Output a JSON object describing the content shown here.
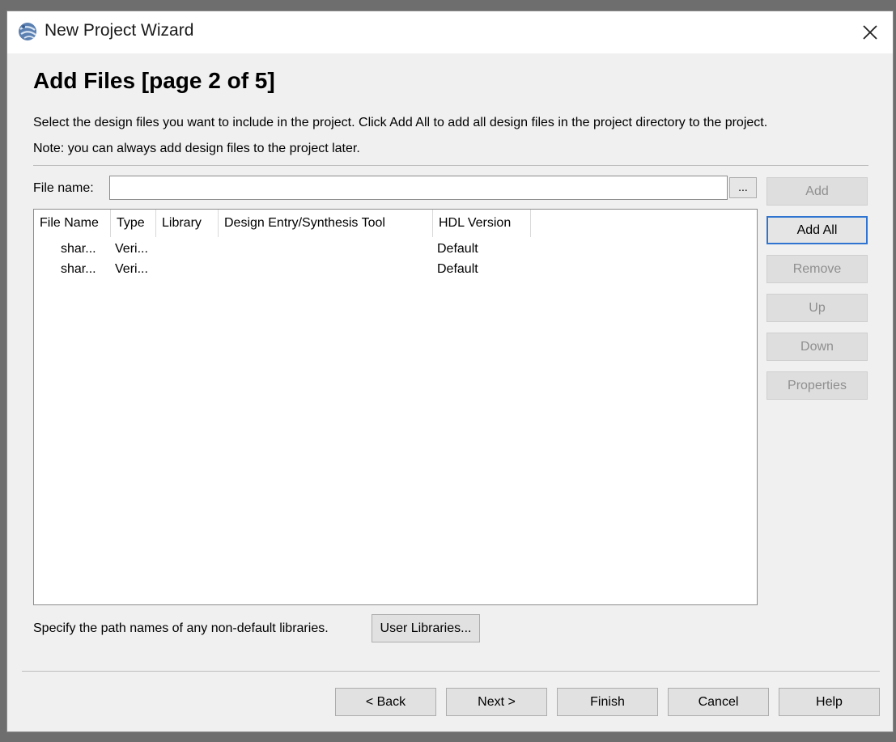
{
  "window": {
    "title": "New Project Wizard",
    "icons": {
      "app": "quartus-globe-icon",
      "close": "close-icon"
    }
  },
  "page": {
    "heading": "Add Files [page 2 of 5]",
    "description_line1": "Select the design files you want to include in the project. Click Add All to add all design files in the project directory to the project.",
    "description_line2": "Note: you can always add design files to the project later."
  },
  "file_name": {
    "label": "File name:",
    "value": "",
    "browse_label": "..."
  },
  "side_buttons": [
    {
      "label": "Add",
      "enabled": false
    },
    {
      "label": "Add All",
      "enabled": true
    },
    {
      "label": "Remove",
      "enabled": false
    },
    {
      "label": "Up",
      "enabled": false
    },
    {
      "label": "Down",
      "enabled": false
    },
    {
      "label": "Properties",
      "enabled": false
    }
  ],
  "table": {
    "columns": [
      "File Name",
      "Type",
      "Library",
      "Design Entry/Synthesis Tool",
      "HDL Version"
    ],
    "rows": [
      [
        "shar...",
        "Veri...",
        "",
        "",
        "Default"
      ],
      [
        "shar...",
        "Veri...",
        "",
        "",
        "Default"
      ]
    ]
  },
  "user_libraries": {
    "label": "Specify the path names of any non-default libraries.",
    "button_label": "User Libraries..."
  },
  "bottom_buttons": {
    "back": "< Back",
    "next": "Next >",
    "finish": "Finish",
    "cancel": "Cancel",
    "help": "Help"
  },
  "colors": {
    "focus_border": "#2f74d0",
    "disabled_text": "#8f8f8f",
    "dialog_bg": "#f0f0f0"
  }
}
